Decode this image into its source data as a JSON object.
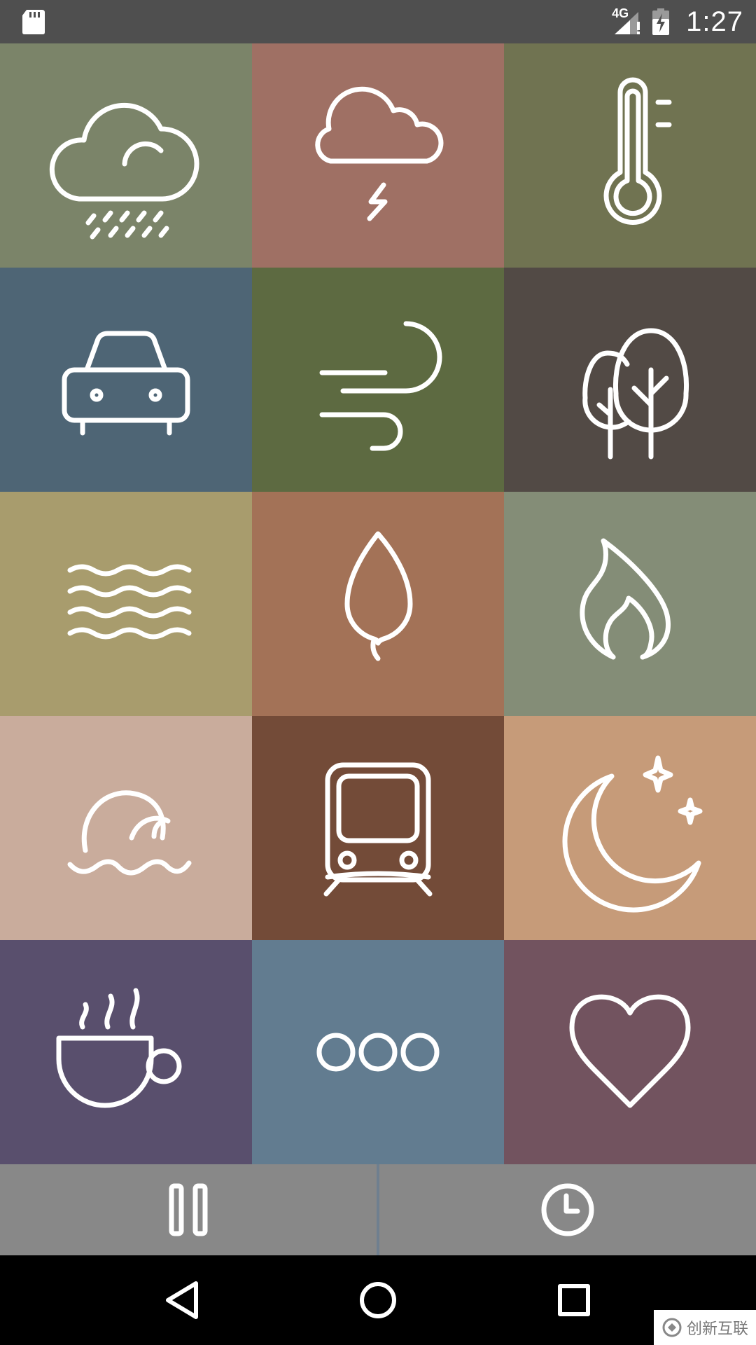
{
  "status_bar": {
    "network_label": "4G",
    "time": "1:27",
    "icons": [
      "sd-card-icon",
      "signal-no-data-icon",
      "battery-charging-icon"
    ]
  },
  "tiles": [
    {
      "name": "rain",
      "icon": "rain-cloud-icon",
      "color": "#7b8469"
    },
    {
      "name": "thunderstorm",
      "icon": "thunderstorm-icon",
      "color": "#9f7064"
    },
    {
      "name": "temperature",
      "icon": "thermometer-icon",
      "color": "#707351"
    },
    {
      "name": "car",
      "icon": "car-icon",
      "color": "#4e6575"
    },
    {
      "name": "wind",
      "icon": "wind-icon",
      "color": "#5d6a41"
    },
    {
      "name": "forest",
      "icon": "trees-icon",
      "color": "#524a45"
    },
    {
      "name": "water",
      "icon": "waves-icon",
      "color": "#a89c6d"
    },
    {
      "name": "leaf",
      "icon": "leaf-drop-icon",
      "color": "#a37257"
    },
    {
      "name": "fire",
      "icon": "flame-icon",
      "color": "#848d77"
    },
    {
      "name": "sea-waves",
      "icon": "ocean-wave-icon",
      "color": "#c9ac9c"
    },
    {
      "name": "train",
      "icon": "train-icon",
      "color": "#734b38"
    },
    {
      "name": "night",
      "icon": "moon-stars-icon",
      "color": "#c69b79"
    },
    {
      "name": "coffee-shop",
      "icon": "coffee-cup-icon",
      "color": "#594f6d"
    },
    {
      "name": "more",
      "icon": "more-dots-icon",
      "color": "#627c90"
    },
    {
      "name": "favorites",
      "icon": "heart-icon",
      "color": "#72535f"
    }
  ],
  "controls": {
    "pause_icon": "pause-icon",
    "timer_icon": "clock-icon",
    "background": "#888888"
  },
  "navigation": {
    "back_icon": "back-triangle-icon",
    "home_icon": "home-circle-icon",
    "recents_icon": "recents-square-icon"
  },
  "watermark": {
    "text": "创新互联"
  }
}
